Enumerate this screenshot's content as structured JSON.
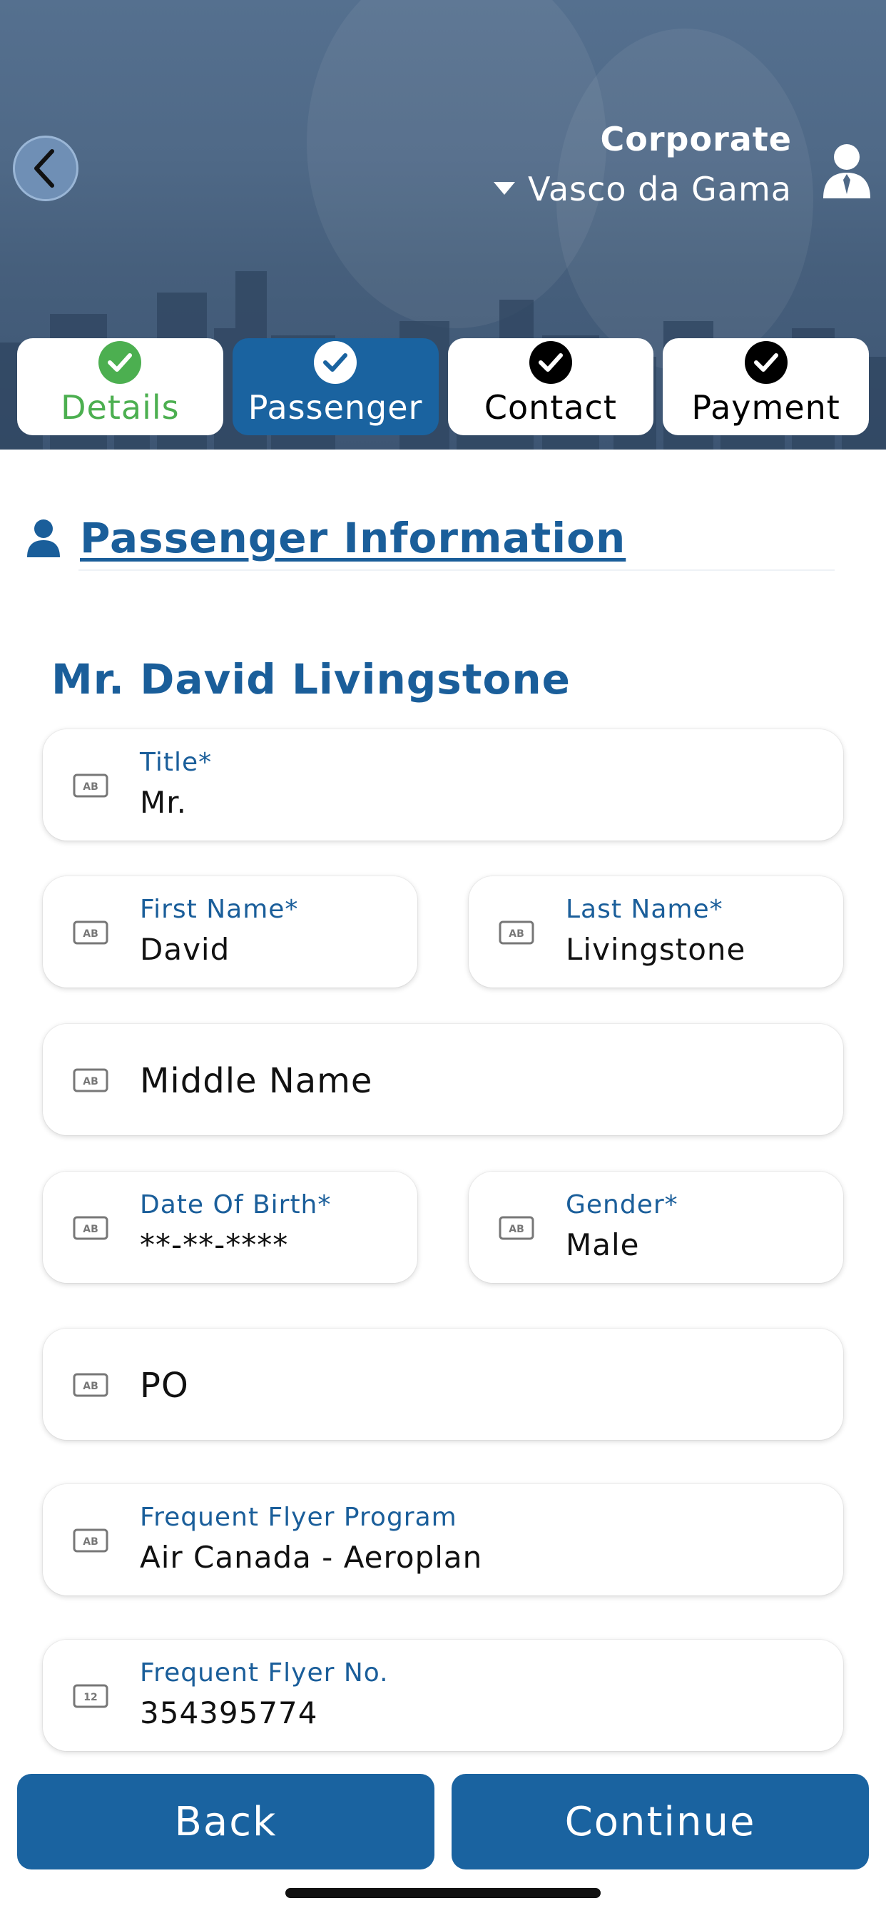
{
  "header": {
    "org": "Corporate",
    "profile_name": "Vasco da Gama"
  },
  "steps": [
    {
      "label": "Details",
      "state": "done"
    },
    {
      "label": "Passenger",
      "state": "active"
    },
    {
      "label": "Contact",
      "state": "todo"
    },
    {
      "label": "Payment",
      "state": "todo"
    }
  ],
  "section": {
    "title": "Passenger Information"
  },
  "passenger": {
    "display_name": "Mr. David Livingstone",
    "fields": {
      "title": {
        "label": "Title*",
        "value": "Mr."
      },
      "first_name": {
        "label": "First Name*",
        "value": "David"
      },
      "last_name": {
        "label": "Last Name*",
        "value": "Livingstone"
      },
      "middle_name": {
        "placeholder": "Middle Name"
      },
      "dob": {
        "label": "Date Of Birth*",
        "value": "**-**-****"
      },
      "gender": {
        "label": "Gender*",
        "value": "Male"
      },
      "po": {
        "placeholder": "PO"
      },
      "ff_program": {
        "label": "Frequent Flyer Program",
        "value": "Air Canada - Aeroplan"
      },
      "ff_number": {
        "label": "Frequent Flyer No.",
        "value": "354395774"
      }
    }
  },
  "footer": {
    "back_label": "Back",
    "continue_label": "Continue"
  },
  "colors": {
    "primary": "#1a63a0",
    "label_blue": "#1a5e9a",
    "success": "#4caf50"
  },
  "icons": {
    "text_field": "text-field-icon",
    "numeric_field": "numeric-field-icon"
  }
}
